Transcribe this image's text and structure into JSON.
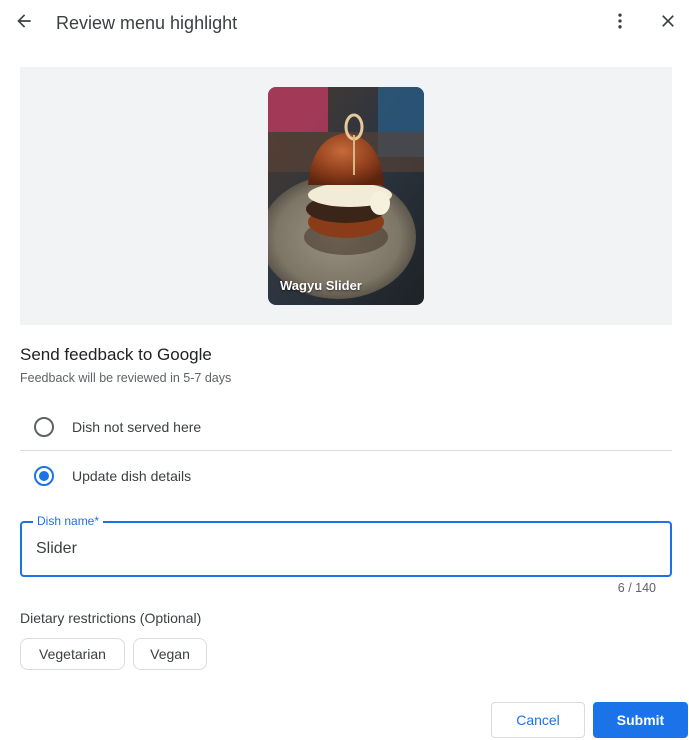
{
  "header": {
    "title": "Review menu highlight",
    "back_icon": "arrow-back-icon",
    "more_icon": "more-vert-icon",
    "close_icon": "close-icon"
  },
  "photo": {
    "caption": "Wagyu Slider"
  },
  "feedback": {
    "title": "Send feedback to Google",
    "subtitle": "Feedback will be reviewed in 5-7 days",
    "options": [
      {
        "label": "Dish not served here",
        "selected": false
      },
      {
        "label": "Update dish details",
        "selected": true
      }
    ]
  },
  "dish_name": {
    "label": "Dish name*",
    "value": "Slider",
    "counter": "6 / 140"
  },
  "dietary": {
    "label": "Dietary restrictions (Optional)",
    "chips": [
      "Vegetarian",
      "Vegan"
    ]
  },
  "actions": {
    "cancel": "Cancel",
    "submit": "Submit"
  },
  "colors": {
    "accent": "#1a73e8",
    "panel_bg": "#f1f3f4",
    "text_primary": "#202124",
    "text_secondary": "#5f6368"
  }
}
